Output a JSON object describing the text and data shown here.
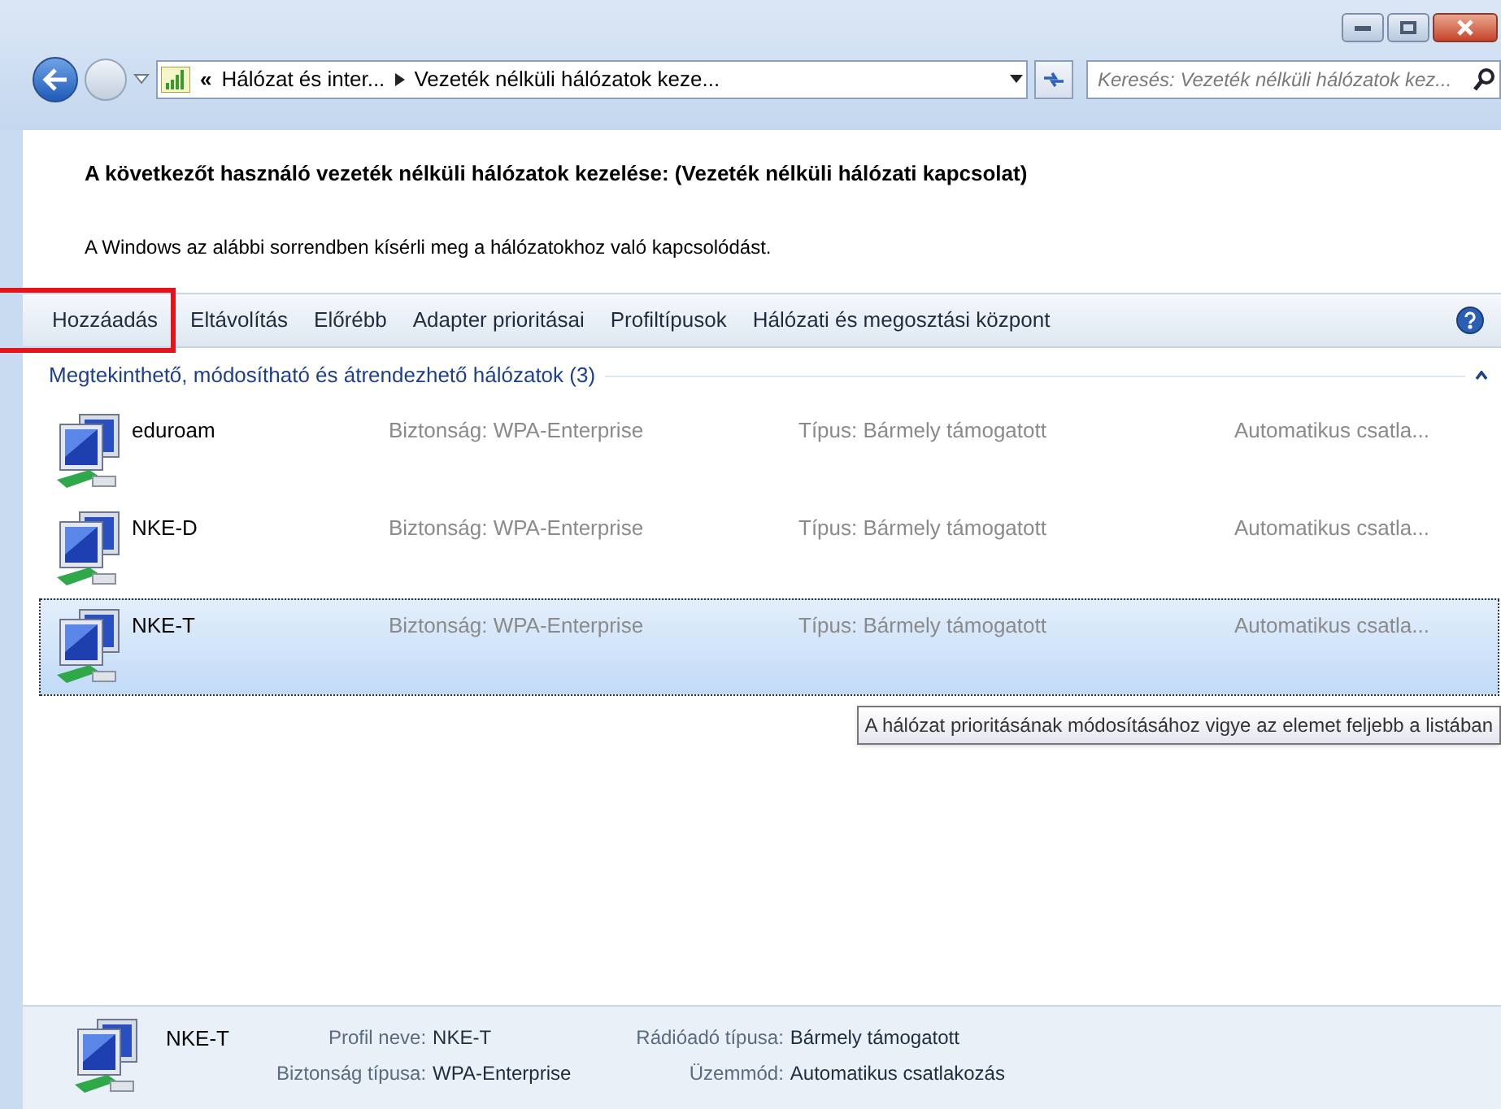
{
  "address_bar": {
    "overflow": "«",
    "crumbs": [
      "Hálózat és inter...",
      "Vezeték nélküli hálózatok keze..."
    ]
  },
  "search": {
    "placeholder": "Keresés: Vezeték nélküli hálózatok kez..."
  },
  "heading": "A következőt használó vezeték nélküli hálózatok kezelése: (Vezeték nélküli hálózati kapcsolat)",
  "description": "A Windows az alábbi sorrendben kísérli meg a hálózatokhoz való kapcsolódást.",
  "toolbar": [
    {
      "label": "Hozzáadás",
      "highlighted": true
    },
    {
      "label": "Eltávolítás",
      "highlighted": false
    },
    {
      "label": "Előrébb",
      "highlighted": false
    },
    {
      "label": "Adapter prioritásai",
      "highlighted": false
    },
    {
      "label": "Profiltípusok",
      "highlighted": false
    },
    {
      "label": "Hálózati és megosztási központ",
      "highlighted": false
    }
  ],
  "group": {
    "title": "Megtekinthető, módosítható és átrendezhető hálózatok (3)",
    "expanded": true
  },
  "networks": [
    {
      "name": "eduroam",
      "security_label": "Biztonság:",
      "security": "WPA-Enterprise",
      "type_label": "Típus:",
      "type": "Bármely támogatott",
      "mode": "Automatikus csatla...",
      "selected": false
    },
    {
      "name": "NKE-D",
      "security_label": "Biztonság:",
      "security": "WPA-Enterprise",
      "type_label": "Típus:",
      "type": "Bármely támogatott",
      "mode": "Automatikus csatla...",
      "selected": false
    },
    {
      "name": "NKE-T",
      "security_label": "Biztonság:",
      "security": "WPA-Enterprise",
      "type_label": "Típus:",
      "type": "Bármely támogatott",
      "mode": "Automatikus csatla...",
      "selected": true
    }
  ],
  "tooltip": "A hálózat prioritásának módosításához vigye az elemet feljebb a listában",
  "details": {
    "name": "NKE-T",
    "fields": [
      {
        "label": "Profil neve:",
        "value": "NKE-T"
      },
      {
        "label": "Rádióadó típusa:",
        "value": "Bármely támogatott"
      },
      {
        "label": "Biztonság típusa:",
        "value": "WPA-Enterprise"
      },
      {
        "label": "Üzemmód:",
        "value": "Automatikus csatlakozás"
      }
    ]
  }
}
